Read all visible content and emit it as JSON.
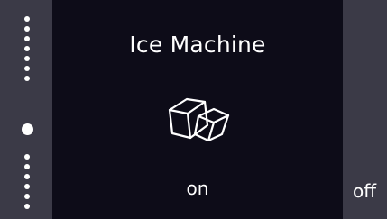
{
  "device": {
    "feature_title": "Ice Machine",
    "feature_icon": "ice-cubes-icon",
    "current_option": "on",
    "next_option": "off"
  },
  "menu_position": {
    "total_items": 13,
    "active_item_index": 7
  },
  "colors": {
    "background_dark": "#0d0c18",
    "side_background": "#3b3a47",
    "text": "#ffffff"
  }
}
